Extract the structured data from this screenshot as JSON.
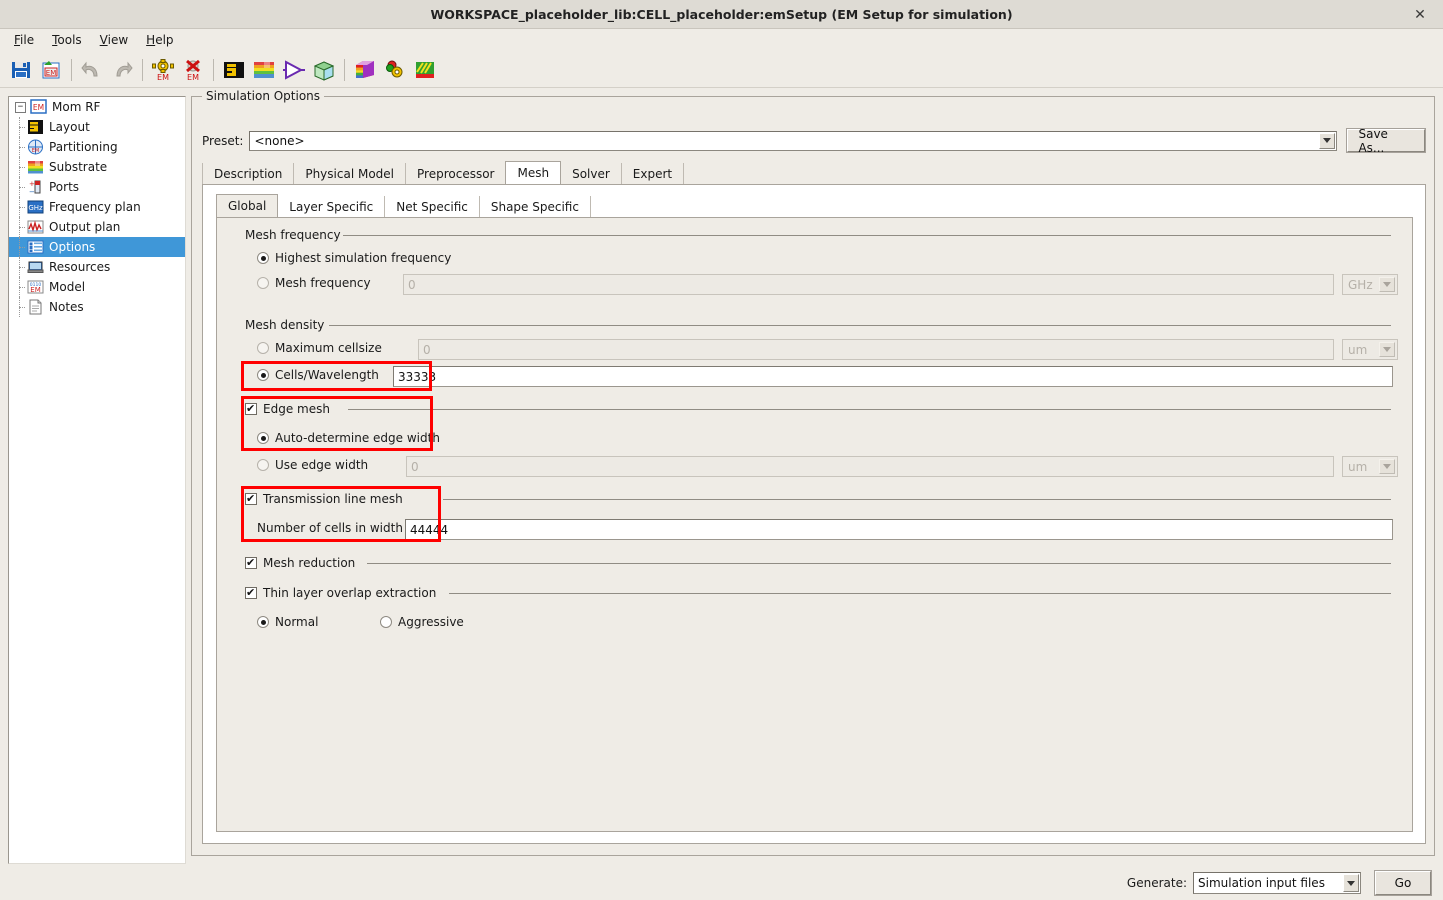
{
  "window": {
    "title": "WORKSPACE_placeholder_lib:CELL_placeholder:emSetup (EM Setup for simulation)",
    "close_label": "✕"
  },
  "menubar": {
    "items": [
      {
        "label": "File",
        "mnemonic": "F"
      },
      {
        "label": "Tools",
        "mnemonic": "T"
      },
      {
        "label": "View",
        "mnemonic": "V"
      },
      {
        "label": "Help",
        "mnemonic": "H"
      }
    ]
  },
  "toolbar": {
    "buttons": [
      {
        "name": "save-icon",
        "tip": "Save"
      },
      {
        "name": "save-em-setup-icon",
        "tip": "Save EM Setup"
      },
      {
        "name": "undo-icon",
        "tip": "Undo"
      },
      {
        "name": "redo-icon",
        "tip": "Redo"
      },
      {
        "name": "em-simulate-icon",
        "tip": "Simulate EM"
      },
      {
        "name": "em-stop-icon",
        "tip": "Stop EM simulation"
      },
      {
        "name": "layout-icon",
        "tip": "Layout"
      },
      {
        "name": "substrate-icon",
        "tip": "Substrate"
      },
      {
        "name": "port-icon",
        "tip": "Ports"
      },
      {
        "name": "mesh-3d-icon",
        "tip": "3D Mesh preview"
      },
      {
        "name": "em-cosim-icon",
        "tip": "EM cosimulation"
      },
      {
        "name": "em-model-icon",
        "tip": "EM model"
      },
      {
        "name": "em-results-icon",
        "tip": "EM results"
      }
    ]
  },
  "sidebar": {
    "root": {
      "label": "Mom RF",
      "icon": "em-root-icon",
      "expander": "−"
    },
    "items": [
      {
        "label": "Layout",
        "icon": "layout-icon",
        "selected": false
      },
      {
        "label": "Partitioning",
        "icon": "partitioning-icon",
        "selected": false
      },
      {
        "label": "Substrate",
        "icon": "substrate-icon",
        "selected": false
      },
      {
        "label": "Ports",
        "icon": "ports-icon",
        "selected": false
      },
      {
        "label": "Frequency plan",
        "icon": "ghz-icon",
        "selected": false
      },
      {
        "label": "Output plan",
        "icon": "output-plan-icon",
        "selected": false
      },
      {
        "label": "Options",
        "icon": "options-icon",
        "selected": true
      },
      {
        "label": "Resources",
        "icon": "resources-icon",
        "selected": false
      },
      {
        "label": "Model",
        "icon": "model-icon",
        "selected": false
      },
      {
        "label": "Notes",
        "icon": "notes-icon",
        "selected": false
      }
    ]
  },
  "main": {
    "groupbox_title": "Simulation Options",
    "preset": {
      "label": "Preset:",
      "value": "<none>",
      "save_as_label": "Save As..."
    },
    "top_tabs": [
      {
        "label": "Description",
        "active": false
      },
      {
        "label": "Physical Model",
        "active": false
      },
      {
        "label": "Preprocessor",
        "active": false
      },
      {
        "label": "Mesh",
        "active": true
      },
      {
        "label": "Solver",
        "active": false
      },
      {
        "label": "Expert",
        "active": false
      }
    ],
    "sub_tabs": [
      {
        "label": "Global",
        "active": true
      },
      {
        "label": "Layer Specific",
        "active": false
      },
      {
        "label": "Net Specific",
        "active": false
      },
      {
        "label": "Shape Specific",
        "active": false
      }
    ],
    "mesh_frequency": {
      "group_label": "Mesh frequency",
      "highest_label": "Highest simulation frequency",
      "highest_selected": true,
      "mesh_freq_label": "Mesh frequency",
      "mesh_freq_selected": false,
      "mesh_freq_value": "0",
      "mesh_freq_unit": "GHz"
    },
    "mesh_density": {
      "group_label": "Mesh density",
      "max_cellsize_label": "Maximum cellsize",
      "max_cellsize_selected": false,
      "max_cellsize_value": "0",
      "max_cellsize_unit": "um",
      "cells_per_wavelength_label": "Cells/Wavelength",
      "cells_per_wavelength_selected": true,
      "cells_per_wavelength_value": "33333",
      "cells_highlighted": true
    },
    "edge_mesh": {
      "group_label": "Edge mesh",
      "checked": true,
      "highlighted": true,
      "auto_label": "Auto-determine edge width",
      "auto_selected": true,
      "use_edge_width_label": "Use edge width",
      "use_edge_width_selected": false,
      "use_edge_width_value": "0",
      "use_edge_width_unit": "um"
    },
    "transmission_line_mesh": {
      "group_label": "Transmission line mesh",
      "checked": true,
      "highlighted": true,
      "cells_in_width_label": "Number of cells in width",
      "cells_in_width_value": "44444"
    },
    "mesh_reduction": {
      "label": "Mesh reduction",
      "checked": true
    },
    "thin_layer": {
      "label": "Thin layer overlap extraction",
      "checked": true,
      "normal_label": "Normal",
      "normal_selected": true,
      "aggressive_label": "Aggressive",
      "aggressive_selected": false
    }
  },
  "bottombar": {
    "generate_label": "Generate:",
    "generate_value": "Simulation input files",
    "go_label": "Go"
  },
  "colors": {
    "highlight_red": "#ff0000",
    "selection_blue": "#3f97d8",
    "window_bg": "#efece6",
    "panel_white": "#ffffff"
  }
}
